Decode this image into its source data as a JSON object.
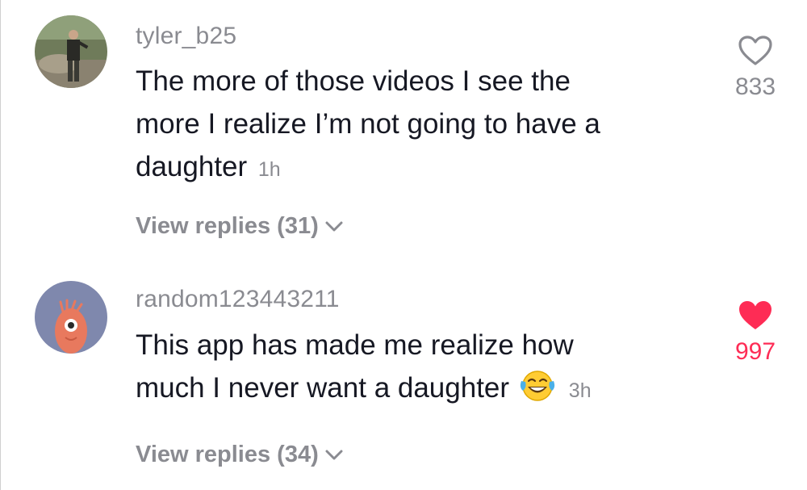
{
  "colors": {
    "secondary_text": "#8a8b91",
    "primary_text": "#161823",
    "like_active": "#fe2c55"
  },
  "comments": [
    {
      "username": "tyler_b25",
      "text_lines": [
        "The more of those videos I see the",
        "more I realize I’m not going to have a",
        "daughter"
      ],
      "time": "1h",
      "likes": "833",
      "liked": false,
      "like_icon": "heart-outline-icon",
      "view_replies": "View replies (31)",
      "chevron_icon": "chevron-down-icon"
    },
    {
      "username": "random123443211",
      "text_lines": [
        "This app has made me realize how",
        "much I never want a daughter"
      ],
      "emoji": "face-with-tears-of-joy-icon",
      "time": "3h",
      "likes": "997",
      "liked": true,
      "like_icon": "heart-filled-icon",
      "view_replies": "View replies (34)",
      "chevron_icon": "chevron-down-icon"
    }
  ]
}
